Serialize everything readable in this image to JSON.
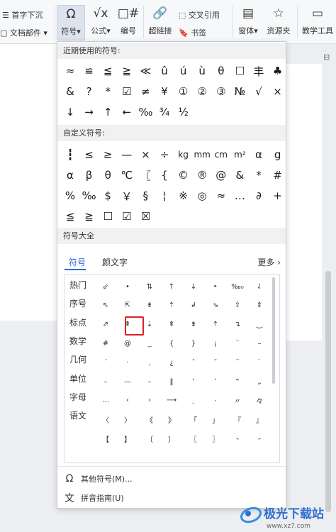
{
  "ribbon": {
    "first_char_sink": "首字下沉",
    "doc_parts": "文档部件",
    "symbol": "符号",
    "formula": "公式",
    "numbering": "编号",
    "cross_ref": "交叉引用",
    "hyperlink": "超链接",
    "bookmark": "书签",
    "font_style": "窗体",
    "resources": "资源夹",
    "teaching_tools": "教学工具"
  },
  "panel": {
    "recent_title": "近期使用的符号:",
    "custom_title": "自定义符号:",
    "all_title": "符号大全",
    "recent_symbols": [
      "≈",
      "≌",
      "≦",
      "≧",
      "≪",
      "û",
      "ú",
      "ù",
      "θ",
      "☐",
      "丰",
      "♣",
      "&",
      "?",
      "*",
      "☑",
      "≠",
      "¥",
      "①",
      "②",
      "③",
      "№",
      "√",
      "×",
      "↓",
      "→",
      "↑",
      "←",
      "‰",
      "¾",
      "½"
    ],
    "custom_symbols": [
      "┇",
      "≤",
      "≥",
      "—",
      "×",
      "÷",
      "kg",
      "mm",
      "cm",
      "m²",
      "α",
      "g",
      "α",
      "β",
      "θ",
      "℃",
      "〖",
      "{",
      "©",
      "®",
      "@",
      "&",
      "*",
      "#",
      "%",
      "‰",
      "$",
      "￥",
      "§",
      "¦",
      "※",
      "◎",
      "≈",
      "…",
      "∂",
      "+",
      "≦",
      "≧",
      "☐",
      "☑",
      "☒"
    ],
    "tabs": [
      "符号",
      "颜文字"
    ],
    "more": "更多",
    "categories": [
      "热门",
      "序号",
      "标点",
      "数学",
      "几何",
      "单位",
      "字母",
      "语文"
    ],
    "grid": [
      [
        "⇙",
        "•",
        "⇅",
        "↑",
        "↓",
        "‣",
        "‰₀",
        "⇃"
      ],
      [
        "⇖",
        "⇱",
        "⇟",
        "⇡",
        "↲",
        "⇘",
        "⇪",
        "⇕"
      ],
      [
        "⇗",
        "⇞",
        "⇣",
        "⇞",
        "⇟",
        "⇡",
        "↴",
        "⏝"
      ],
      [
        "#",
        "@",
        "_",
        "{",
        "}",
        "¡",
        "¨",
        "–"
      ],
      [
        "ˊ",
        "·",
        "ˌ",
        "¿",
        "ˆ",
        "ˇ",
        "˘",
        "ˋ"
      ],
      [
        "–",
        "—",
        "–",
        "‖",
        "ʻ",
        "ʼ",
        "‟",
        "„"
      ],
      [
        "…",
        "‹",
        "›",
        "⟶",
        "ˎ",
        "˴",
        "〃",
        "々"
      ],
      [
        "〈",
        "〉",
        "《",
        "》",
        "「",
        "」",
        "『",
        "』"
      ],
      [
        "【",
        "】",
        "〔",
        "〕",
        "〖",
        "〗",
        "˵",
        "˶"
      ]
    ],
    "other_symbols": "其他符号(M)...",
    "pinyin_guide": "拼音指南(U)"
  },
  "watermark": {
    "text": "极光下载站",
    "sub": "www.xz7.com"
  },
  "colors": {
    "accent": "#2a6bd8",
    "highlight": "#e02020"
  }
}
